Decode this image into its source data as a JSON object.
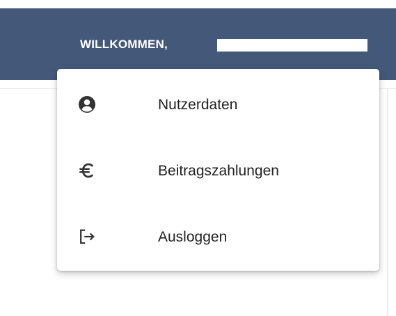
{
  "header": {
    "welcome_text": "WILLKOMMEN,"
  },
  "menu": {
    "items": [
      {
        "label": "Nutzerdaten",
        "icon": "account-circle-icon"
      },
      {
        "label": "Beitragszahlungen",
        "icon": "euro-icon"
      },
      {
        "label": "Ausloggen",
        "icon": "logout-icon"
      }
    ]
  },
  "colors": {
    "header_bg": "#44597a",
    "header_text": "#ffffff",
    "menu_text": "#222222",
    "icon": "#333333"
  }
}
